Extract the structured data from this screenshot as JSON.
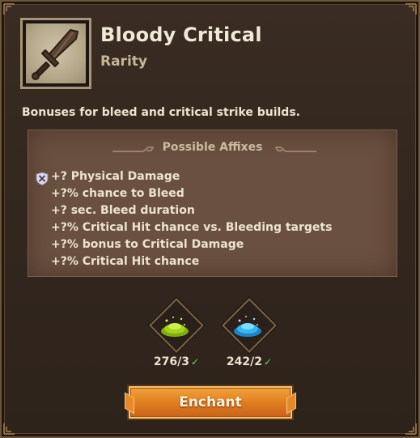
{
  "item": {
    "name": "Bloody Critical",
    "rarity": "Rarity",
    "description": "Bonuses for bleed and critical strike builds.",
    "icon": "sword-icon"
  },
  "affixes": {
    "header": "Possible Affixes",
    "items": [
      "+? Physical Damage",
      "+?% chance to Bleed",
      "+? sec. Bleed duration",
      "+?% Critical Hit chance vs. Bleeding targets",
      "+?% bonus to Critical Damage",
      "+?% Critical Hit chance"
    ]
  },
  "materials": [
    {
      "name": "green-dust-icon",
      "count": "276/3",
      "color": "#a6d21e"
    },
    {
      "name": "blue-dust-icon",
      "count": "242/2",
      "color": "#36b6f0"
    }
  ],
  "actions": {
    "enchant_label": "Enchant"
  },
  "colors": {
    "accent": "#e0801f",
    "check": "#6fd45a",
    "panel": "#33271e"
  }
}
